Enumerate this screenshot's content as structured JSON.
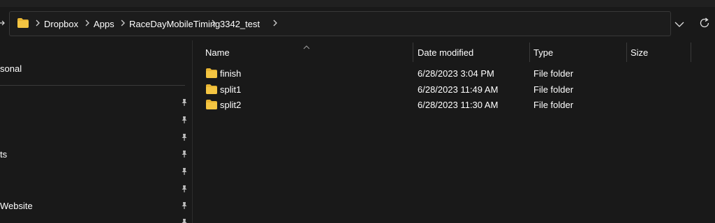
{
  "breadcrumb": [
    "Dropbox",
    "Apps",
    "RaceDayMobileTiming",
    "3342_test"
  ],
  "nav_pane": {
    "labels": [
      "sonal",
      "ts",
      "Website"
    ]
  },
  "columns": {
    "name": "Name",
    "date_modified": "Date modified",
    "type": "Type",
    "size": "Size"
  },
  "files": [
    {
      "name": "finish",
      "date_modified": "6/28/2023 3:04 PM",
      "type": "File folder",
      "size": ""
    },
    {
      "name": "split1",
      "date_modified": "6/28/2023 11:49 AM",
      "type": "File folder",
      "size": ""
    },
    {
      "name": "split2",
      "date_modified": "6/28/2023 11:30 AM",
      "type": "File folder",
      "size": ""
    }
  ],
  "colors": {
    "background": "#191919",
    "folder": "#f4c542",
    "text": "#ffffff",
    "divider": "#3a3a3a"
  },
  "icons": [
    "up-arrow-icon",
    "folder-icon",
    "chevron-right-icon",
    "chevron-down-icon",
    "refresh-icon",
    "pin-icon",
    "sort-ascending-icon"
  ]
}
